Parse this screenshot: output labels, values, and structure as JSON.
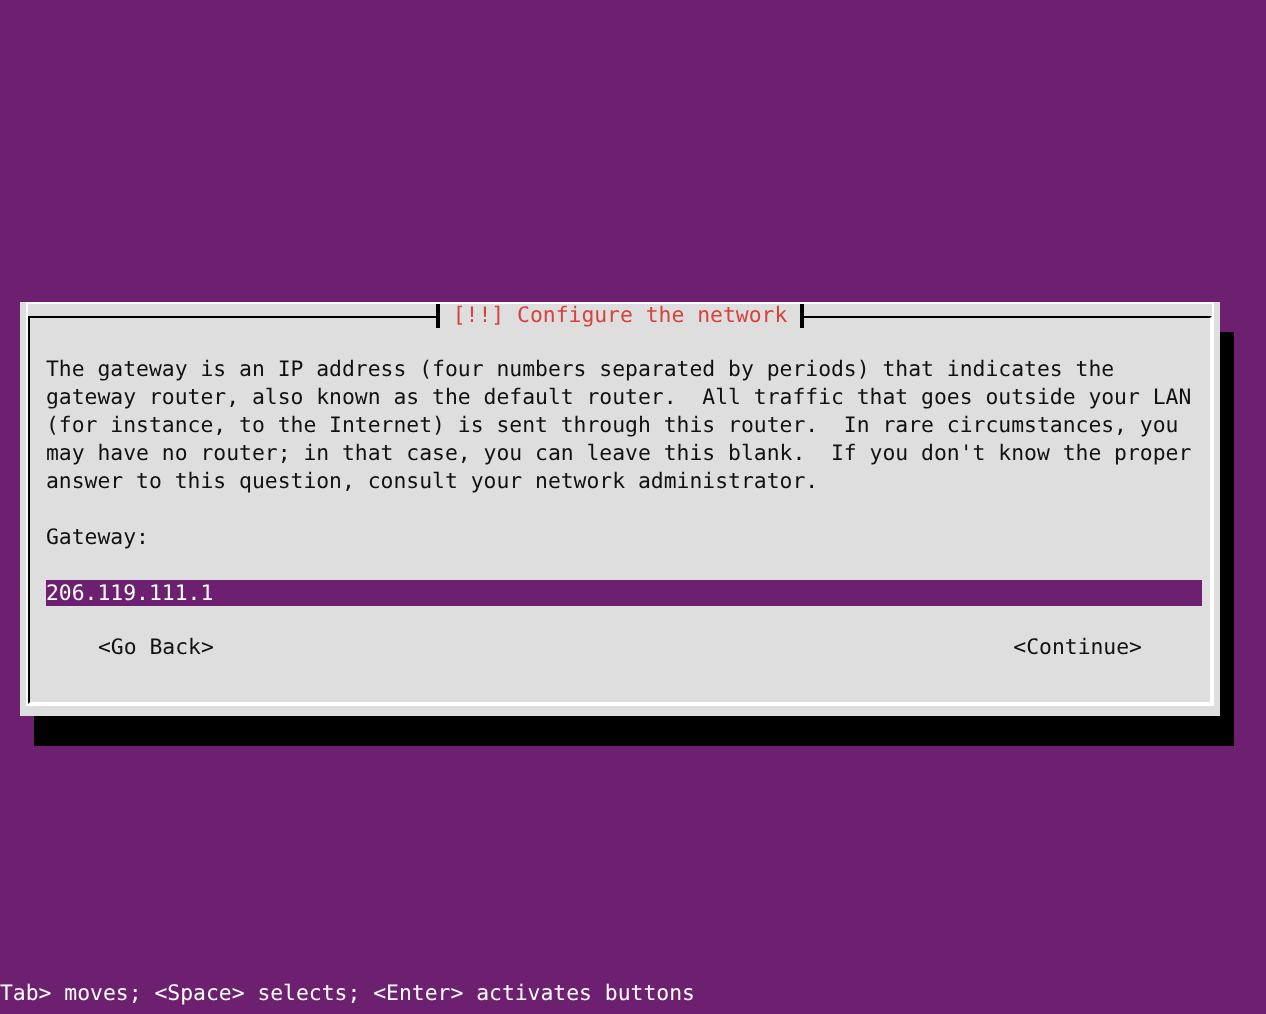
{
  "dialog": {
    "title": "[!!] Configure the network",
    "description": "The gateway is an IP address (four numbers separated by periods) that indicates the\ngateway router, also known as the default router.  All traffic that goes outside your LAN\n(for instance, to the Internet) is sent through this router.  In rare circumstances, you\nmay have no router; in that case, you can leave this blank.  If you don't know the proper\nanswer to this question, consult your network administrator.",
    "field": {
      "label": "Gateway:",
      "value": "206.119.111.1"
    },
    "buttons": [
      {
        "label": "<Go Back>"
      },
      {
        "label": "<Continue>"
      }
    ]
  },
  "status_bar": "Tab> moves; <Space> selects; <Enter> activates buttons"
}
